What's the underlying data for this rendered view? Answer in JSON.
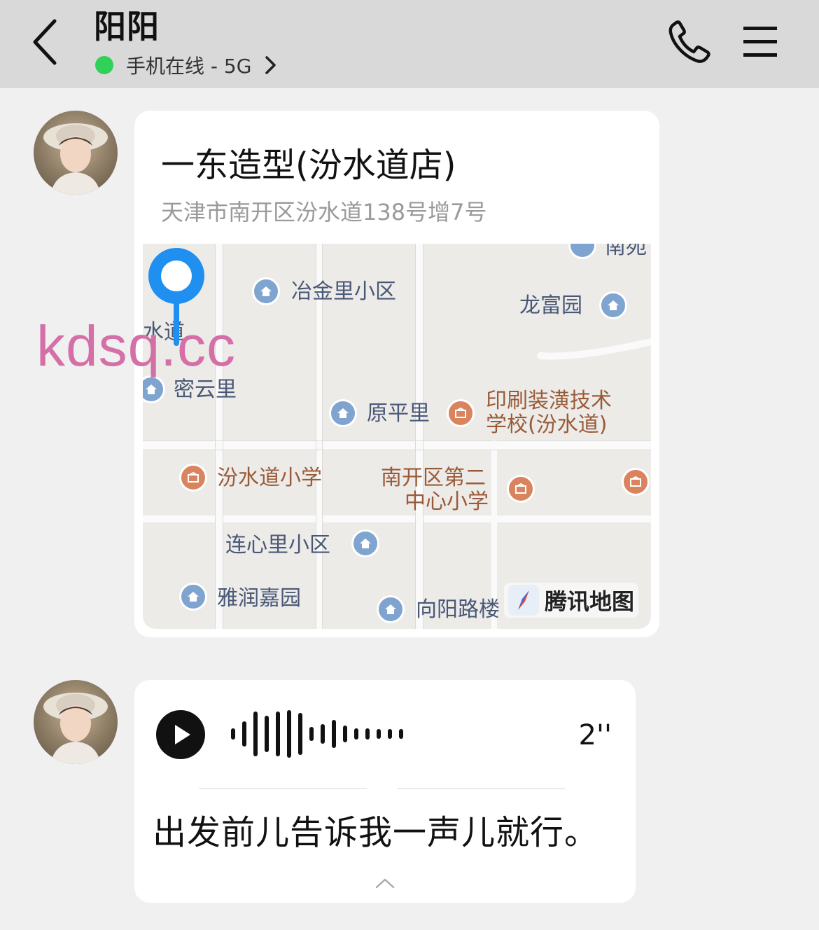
{
  "header": {
    "contact_name": "阳阳",
    "status_text": "手机在线 - 5G",
    "status_color": "#30d158",
    "back_icon": "chevron-left-icon",
    "call_icon": "phone-icon",
    "menu_icon": "hamburger-menu-icon"
  },
  "messages": [
    {
      "type": "location",
      "place_name": "一东造型(汾水道店)",
      "address": "天津市南开区汾水道138号增7号",
      "map": {
        "provider": "腾讯地图",
        "labels": {
          "nanyuan": "南苑",
          "yejinli": "冶金里小区",
          "longfuyuan": "龙富园",
          "shuidao": "水道",
          "miyunli": "密云里",
          "yuanpingli": "原平里",
          "printing_school": "印刷装潢技术\n学校(汾水道)",
          "printing_school_l1": "印刷装潢技术",
          "printing_school_l2": "学校(汾水道)",
          "fenshuidao_school": "汾水道小学",
          "center_school_l1": "南开区第二",
          "center_school_l2": "中心小学",
          "lianxinli": "连心里小区",
          "yarunjiayuan": "雅润嘉园",
          "xiangyanglu": "向阳路楼"
        },
        "pin_color": "#1f8ff0"
      }
    },
    {
      "type": "voice",
      "duration": "2''",
      "transcript": "出发前儿告诉我一声儿就行。"
    }
  ],
  "watermark": "kdsq.cc"
}
